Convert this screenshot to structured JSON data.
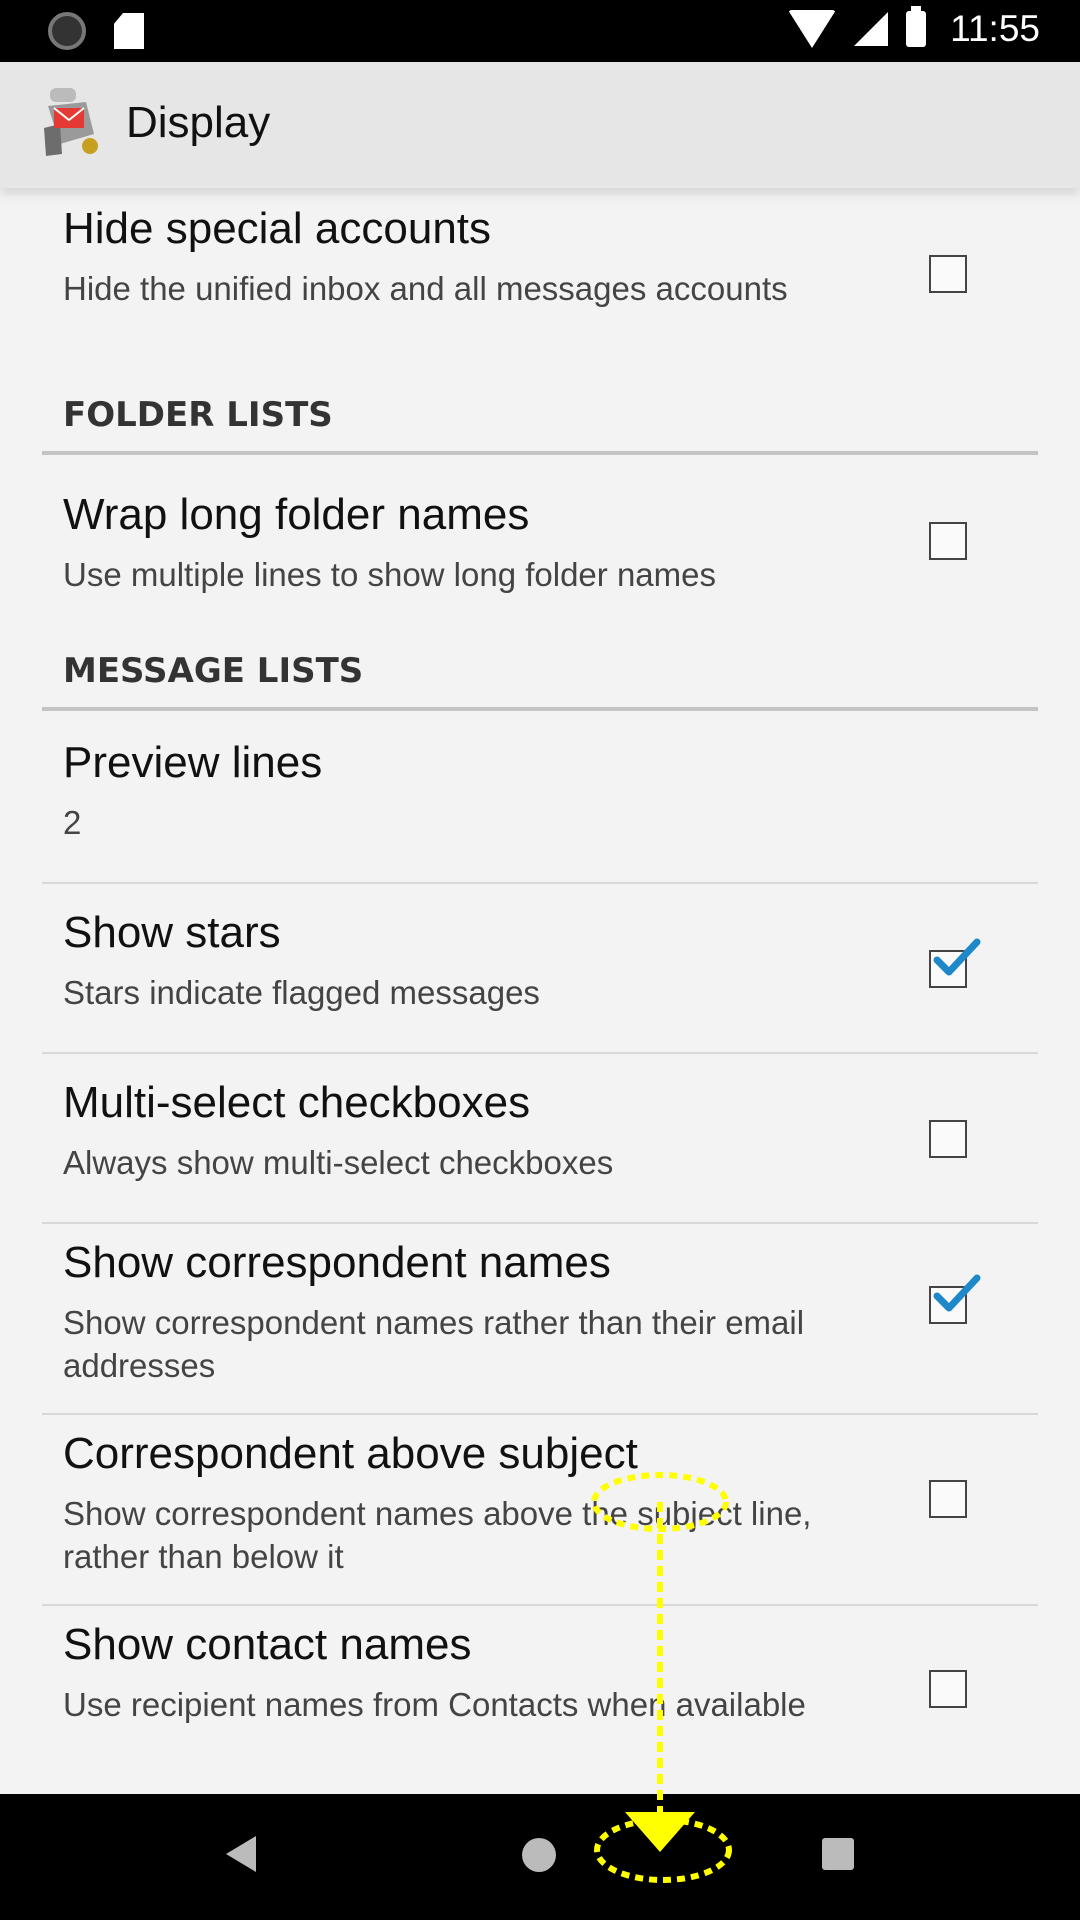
{
  "statusbar": {
    "time": "11:55"
  },
  "appbar": {
    "title": "Display"
  },
  "prefs": {
    "hide_special": {
      "title": "Hide special accounts",
      "summary": "Hide the unified inbox and all messages accounts",
      "checked": false
    },
    "folder_section": "FOLDER LISTS",
    "wrap_folder": {
      "title": "Wrap long folder names",
      "summary": "Use multiple lines to show long folder names",
      "checked": false
    },
    "message_section": "MESSAGE LISTS",
    "preview_lines": {
      "title": "Preview lines",
      "value": "2"
    },
    "show_stars": {
      "title": "Show stars",
      "summary": "Stars indicate flagged messages",
      "checked": true
    },
    "multi_select": {
      "title": "Multi-select checkboxes",
      "summary": "Always show multi-select checkboxes",
      "checked": false
    },
    "correspondent_names": {
      "title": "Show correspondent names",
      "summary": "Show correspondent names rather than their email addresses",
      "checked": true
    },
    "correspondent_above": {
      "title": "Correspondent above subject",
      "summary": "Show correspondent names above the subject line, rather than below it",
      "checked": false
    },
    "contact_names": {
      "title": "Show contact names",
      "summary": "Use recipient names from Contacts when available",
      "checked": false
    }
  },
  "colors": {
    "accent": "#1e88c8",
    "highlight": "#ffff00"
  }
}
